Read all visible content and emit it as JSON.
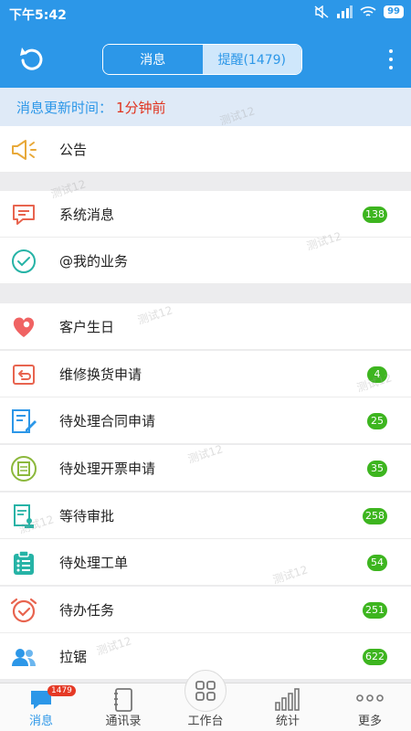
{
  "status_bar": {
    "time": "下午5:42",
    "battery": "99"
  },
  "header": {
    "tabs": [
      {
        "label": "消息"
      },
      {
        "label": "提醒(1479)"
      }
    ]
  },
  "update_info": {
    "label": "消息更新时间：",
    "value": "1分钟前"
  },
  "sections": [
    {
      "items": [
        {
          "label": "公告",
          "icon": "megaphone-icon"
        }
      ]
    },
    {
      "items": [
        {
          "label": "系统消息",
          "icon": "chat-icon",
          "badge": "138"
        },
        {
          "label": "@我的业务",
          "icon": "check-circle-icon"
        }
      ]
    },
    {
      "items": [
        {
          "label": "客户生日",
          "icon": "heart-icon"
        },
        {
          "label": "维修换货申请",
          "icon": "return-box-icon",
          "badge": "4"
        },
        {
          "label": "待处理合同申请",
          "icon": "contract-edit-icon",
          "badge": "25"
        },
        {
          "label": "待处理开票申请",
          "icon": "invoice-icon",
          "badge": "35"
        },
        {
          "label": "等待审批",
          "icon": "approval-doc-icon",
          "badge": "258"
        },
        {
          "label": "待处理工单",
          "icon": "clipboard-list-icon",
          "badge": "54"
        },
        {
          "label": "待办任务",
          "icon": "alarm-clock-icon",
          "badge": "251"
        },
        {
          "label": "拉锯",
          "icon": "users-icon",
          "badge": "622"
        }
      ]
    }
  ],
  "watermark": "测试12",
  "tabbar": {
    "items": [
      {
        "label": "消息",
        "icon": "message-bubble-icon",
        "badge": "1479"
      },
      {
        "label": "通讯录",
        "icon": "address-book-icon"
      },
      {
        "label": "工作台",
        "icon": "grid-icon"
      },
      {
        "label": "统计",
        "icon": "bar-chart-icon"
      },
      {
        "label": "更多",
        "icon": "more-dots-icon"
      }
    ]
  },
  "colors": {
    "primary": "#2c97e8",
    "badge": "#3db51f",
    "alert": "#e0321d"
  }
}
